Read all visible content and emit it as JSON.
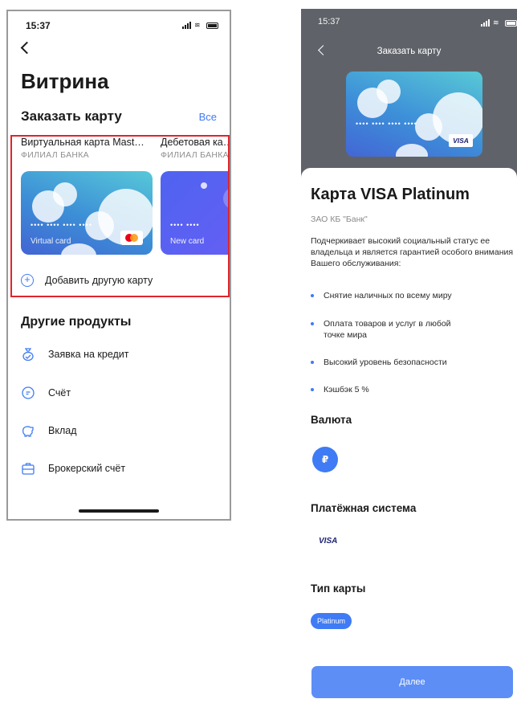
{
  "status_bar": {
    "time": "15:37"
  },
  "left_screen": {
    "title": "Витрина",
    "order_card_section": {
      "title": "Заказать карту",
      "all_link": "Все"
    },
    "cards": [
      {
        "name": "Виртуальная карта Mast…",
        "bank": "ФИЛИАЛ БАНКА",
        "number_mask": "•••• •••• •••• ••••",
        "label": "Virtual card",
        "brand": "mastercard"
      },
      {
        "name": "Дебетовая ка…",
        "bank": "ФИЛИАЛ БАНКА",
        "number_mask": "•••• ••••",
        "label": "New card"
      }
    ],
    "add_card_label": "Добавить другую карту",
    "other_products": {
      "title": "Другие продукты",
      "items": [
        {
          "label": "Заявка на кредит",
          "icon": "money-bag-icon"
        },
        {
          "label": "Счёт",
          "icon": "account-icon"
        },
        {
          "label": "Вклад",
          "icon": "piggy-bank-icon"
        },
        {
          "label": "Брокерский счёт",
          "icon": "briefcase-icon"
        }
      ]
    }
  },
  "right_screen": {
    "header_title": "Заказать карту",
    "card_number_mask": "•••• •••• •••• ••••",
    "card_brand": "VISA",
    "product_title": "Карта VISA Platinum",
    "bank_name": "ЗАО КБ \"Банк\"",
    "description": "Подчеркивает высокий социальный статус ее владельца и является гарантией особого внимания Вашего обслуживания:",
    "features": [
      "Снятие наличных по всему миру",
      "Оплата товаров и услуг в любой точке мира",
      "Высокий уровень безопасности",
      "Кэшбэк 5 %"
    ],
    "currency": {
      "title": "Валюта",
      "symbol": "₽"
    },
    "payment_system": {
      "title": "Платёжная система",
      "value": "VISA"
    },
    "card_type": {
      "title": "Тип карты",
      "value": "Platinum"
    },
    "next_button": "Далее"
  },
  "colors": {
    "accent": "#3f7bf4",
    "highlight_border": "#e0242b",
    "header_bg": "#5f6369"
  }
}
